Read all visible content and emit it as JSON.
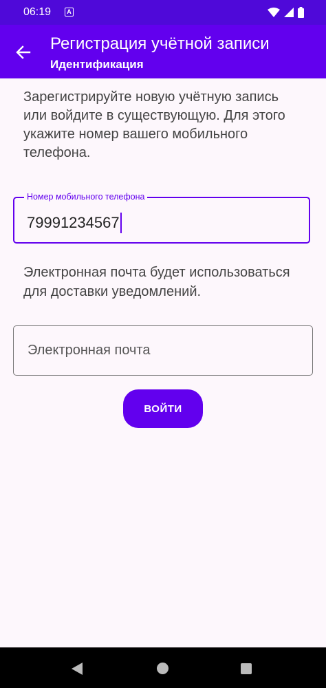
{
  "status_bar": {
    "time": "06:19",
    "notification_icon": "a-box-icon",
    "icons": [
      "wifi-icon",
      "signal-icon",
      "battery-icon"
    ]
  },
  "app_bar": {
    "back_icon": "arrow-back-icon",
    "title": "Регистрация учётной записи",
    "subtitle": "Идентификация"
  },
  "main": {
    "intro_text": "Зарегистрируйте новую учётную запись или войдите в существующую. Для этого укажите номер вашего мобильного телефона.",
    "phone_field": {
      "label": "Номер мобильного телефона",
      "value": "79991234567"
    },
    "email_note": "Электронная почта будет использоваться для доставки уведомлений.",
    "email_field": {
      "placeholder": "Электронная почта",
      "value": ""
    },
    "login_button": "ВОЙТИ"
  },
  "nav_bar": {
    "icons": [
      "nav-back-icon",
      "nav-home-icon",
      "nav-recents-icon"
    ]
  },
  "colors": {
    "primary": "#6200ee",
    "status_bar": "#4f09d9",
    "background": "#fdf7fc"
  }
}
